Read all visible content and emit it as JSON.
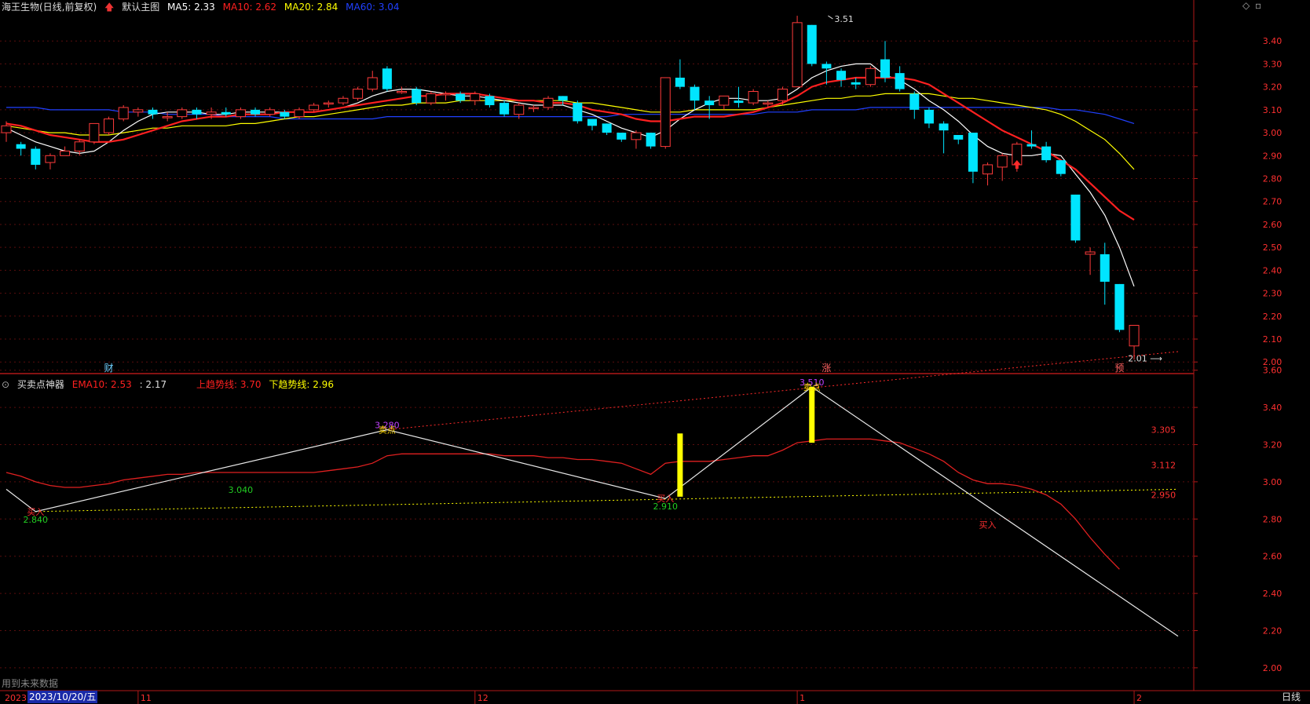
{
  "header": {
    "title": "海王生物(日线,前复权)",
    "template": "默认主图",
    "ma": [
      {
        "label": "MA5: 2.33",
        "color": "#ffffff"
      },
      {
        "label": "MA10: 2.62",
        "color": "#ff2020"
      },
      {
        "label": "MA20: 2.84",
        "color": "#ffff00"
      },
      {
        "label": "MA60: 3.04",
        "color": "#2040ff"
      }
    ]
  },
  "indicator_header": {
    "name": "买卖点神器",
    "ema_label": "EMA10: 2.53",
    "ema_color": "#ff2020",
    "val_label": ": 2.17",
    "up_label": "上趋势线: 3.70",
    "up_color": "#ff2020",
    "down_label": "下趋势线: 2.96",
    "down_color": "#ffff00"
  },
  "footer": {
    "future_note": "用到未来数据",
    "date": "2023/10/20/五",
    "year_stub": "2023",
    "timeframe": "日线"
  },
  "chart_data": [
    {
      "type": "candlestick",
      "title": "海王生物(日线,前复权)",
      "ylim": [
        1.97,
        3.5
      ],
      "yticks": [
        "3.40",
        "3.30",
        "3.20",
        "3.10",
        "3.00",
        "2.90",
        "2.80",
        "2.70",
        "2.60",
        "2.50",
        "2.40",
        "2.30",
        "2.20",
        "2.10",
        "2.00"
      ],
      "month_labels": [
        {
          "label": "11",
          "index": 9
        },
        {
          "label": "12",
          "index": 32
        },
        {
          "label": "1",
          "index": 54
        },
        {
          "label": "2",
          "index": 77
        }
      ],
      "event_marks": [
        {
          "label": "财",
          "index": 7
        },
        {
          "label": "涨",
          "index": 56
        },
        {
          "label": "预",
          "index": 76
        }
      ],
      "annotations": [
        {
          "label": "3.51",
          "index": 56,
          "y": 3.51
        },
        {
          "label": "2.01",
          "index": 80,
          "y": 2.01
        }
      ],
      "candles": [
        [
          3.0,
          3.03,
          3.05,
          2.96
        ],
        [
          2.95,
          2.93,
          2.96,
          2.9
        ],
        [
          2.93,
          2.86,
          2.94,
          2.84
        ],
        [
          2.87,
          2.9,
          2.91,
          2.84
        ],
        [
          2.9,
          2.92,
          2.94,
          2.9
        ],
        [
          2.92,
          2.96,
          2.97,
          2.9
        ],
        [
          2.96,
          3.04,
          3.04,
          2.95
        ],
        [
          3.0,
          3.06,
          3.07,
          2.99
        ],
        [
          3.06,
          3.11,
          3.12,
          3.05
        ],
        [
          3.09,
          3.1,
          3.11,
          3.07
        ],
        [
          3.1,
          3.08,
          3.11,
          3.06
        ],
        [
          3.07,
          3.07,
          3.09,
          3.05
        ],
        [
          3.07,
          3.1,
          3.11,
          3.06
        ],
        [
          3.1,
          3.08,
          3.11,
          3.06
        ],
        [
          3.08,
          3.09,
          3.11,
          3.06
        ],
        [
          3.09,
          3.08,
          3.11,
          3.07
        ],
        [
          3.07,
          3.1,
          3.11,
          3.06
        ],
        [
          3.1,
          3.08,
          3.11,
          3.07
        ],
        [
          3.08,
          3.1,
          3.11,
          3.07
        ],
        [
          3.09,
          3.07,
          3.1,
          3.06
        ],
        [
          3.07,
          3.1,
          3.11,
          3.06
        ],
        [
          3.1,
          3.12,
          3.13,
          3.09
        ],
        [
          3.13,
          3.13,
          3.14,
          3.11
        ],
        [
          3.13,
          3.15,
          3.16,
          3.12
        ],
        [
          3.15,
          3.19,
          3.2,
          3.14
        ],
        [
          3.19,
          3.24,
          3.27,
          3.18
        ],
        [
          3.28,
          3.19,
          3.29,
          3.18
        ],
        [
          3.18,
          3.18,
          3.2,
          3.17
        ],
        [
          3.19,
          3.13,
          3.2,
          3.12
        ],
        [
          3.13,
          3.17,
          3.18,
          3.12
        ],
        [
          3.17,
          3.17,
          3.18,
          3.14
        ],
        [
          3.17,
          3.14,
          3.18,
          3.13
        ],
        [
          3.14,
          3.17,
          3.18,
          3.12
        ],
        [
          3.16,
          3.12,
          3.17,
          3.11
        ],
        [
          3.13,
          3.08,
          3.14,
          3.07
        ],
        [
          3.08,
          3.12,
          3.13,
          3.06
        ],
        [
          3.11,
          3.11,
          3.12,
          3.09
        ],
        [
          3.11,
          3.15,
          3.16,
          3.1
        ],
        [
          3.16,
          3.14,
          3.16,
          3.12
        ],
        [
          3.13,
          3.05,
          3.14,
          3.04
        ],
        [
          3.06,
          3.03,
          3.06,
          3.01
        ],
        [
          3.04,
          3.0,
          3.04,
          2.99
        ],
        [
          3.0,
          2.97,
          3.0,
          2.96
        ],
        [
          2.97,
          3.0,
          3.01,
          2.93
        ],
        [
          3.0,
          2.94,
          3.0,
          2.93
        ],
        [
          2.94,
          3.24,
          3.24,
          2.93
        ],
        [
          3.24,
          3.2,
          3.32,
          3.19
        ],
        [
          3.2,
          3.14,
          3.21,
          3.1
        ],
        [
          3.14,
          3.12,
          3.16,
          3.06
        ],
        [
          3.12,
          3.16,
          3.16,
          3.1
        ],
        [
          3.14,
          3.13,
          3.2,
          3.11
        ],
        [
          3.13,
          3.18,
          3.19,
          3.12
        ],
        [
          3.13,
          3.13,
          3.14,
          3.11
        ],
        [
          3.14,
          3.19,
          3.2,
          3.12
        ],
        [
          3.2,
          3.48,
          3.51,
          3.2
        ],
        [
          3.47,
          3.3,
          3.47,
          3.29
        ],
        [
          3.3,
          3.28,
          3.31,
          3.21
        ],
        [
          3.27,
          3.23,
          3.28,
          3.2
        ],
        [
          3.22,
          3.21,
          3.24,
          3.19
        ],
        [
          3.21,
          3.28,
          3.29,
          3.2
        ],
        [
          3.32,
          3.24,
          3.4,
          3.22
        ],
        [
          3.26,
          3.19,
          3.29,
          3.18
        ],
        [
          3.17,
          3.1,
          3.18,
          3.06
        ],
        [
          3.1,
          3.04,
          3.11,
          3.02
        ],
        [
          3.04,
          3.01,
          3.05,
          2.91
        ],
        [
          2.99,
          2.97,
          2.99,
          2.95
        ],
        [
          3.0,
          2.83,
          3.0,
          2.78
        ],
        [
          2.82,
          2.86,
          2.87,
          2.77
        ],
        [
          2.85,
          2.9,
          2.91,
          2.79
        ],
        [
          2.86,
          2.95,
          2.96,
          2.83
        ],
        [
          2.95,
          2.94,
          3.01,
          2.93
        ],
        [
          2.94,
          2.88,
          2.96,
          2.87
        ],
        [
          2.88,
          2.82,
          2.88,
          2.81
        ],
        [
          2.73,
          2.53,
          2.73,
          2.52
        ],
        [
          2.47,
          2.48,
          2.5,
          2.38
        ],
        [
          2.47,
          2.35,
          2.52,
          2.25
        ],
        [
          2.34,
          2.14,
          2.34,
          2.13
        ],
        [
          2.07,
          2.16,
          2.16,
          2.01
        ]
      ],
      "series": [
        {
          "name": "MA5",
          "color": "#ffffff",
          "values": [
            3.02,
            2.99,
            2.96,
            2.94,
            2.92,
            2.91,
            2.92,
            2.96,
            3.01,
            3.05,
            3.08,
            3.09,
            3.09,
            3.09,
            3.08,
            3.08,
            3.09,
            3.09,
            3.09,
            3.09,
            3.09,
            3.09,
            3.1,
            3.11,
            3.13,
            3.16,
            3.18,
            3.19,
            3.19,
            3.18,
            3.17,
            3.16,
            3.16,
            3.15,
            3.14,
            3.13,
            3.12,
            3.12,
            3.12,
            3.1,
            3.08,
            3.05,
            3.02,
            3.0,
            2.98,
            3.01,
            3.06,
            3.1,
            3.13,
            3.15,
            3.15,
            3.14,
            3.14,
            3.15,
            3.19,
            3.24,
            3.27,
            3.29,
            3.3,
            3.3,
            3.25,
            3.23,
            3.19,
            3.14,
            3.1,
            3.05,
            2.99,
            2.94,
            2.91,
            2.9,
            2.9,
            2.91,
            2.9,
            2.82,
            2.74,
            2.64,
            2.5,
            2.33
          ]
        },
        {
          "name": "MA10",
          "color": "#ff2020",
          "values": [
            3.04,
            3.03,
            3.01,
            2.99,
            2.98,
            2.97,
            2.96,
            2.96,
            2.97,
            2.99,
            3.01,
            3.03,
            3.05,
            3.06,
            3.07,
            3.07,
            3.08,
            3.08,
            3.08,
            3.09,
            3.09,
            3.09,
            3.1,
            3.11,
            3.12,
            3.13,
            3.14,
            3.15,
            3.16,
            3.16,
            3.17,
            3.17,
            3.17,
            3.16,
            3.15,
            3.14,
            3.14,
            3.13,
            3.13,
            3.12,
            3.1,
            3.09,
            3.08,
            3.06,
            3.05,
            3.05,
            3.06,
            3.07,
            3.07,
            3.07,
            3.08,
            3.09,
            3.11,
            3.13,
            3.16,
            3.2,
            3.22,
            3.23,
            3.24,
            3.24,
            3.24,
            3.24,
            3.23,
            3.21,
            3.17,
            3.13,
            3.09,
            3.05,
            3.01,
            2.98,
            2.95,
            2.92,
            2.88,
            2.84,
            2.78,
            2.72,
            2.66,
            2.62
          ]
        },
        {
          "name": "MA20",
          "color": "#ffff00",
          "values": [
            3.03,
            3.02,
            3.01,
            3.0,
            3.0,
            2.99,
            2.99,
            2.99,
            3.0,
            3.01,
            3.02,
            3.02,
            3.03,
            3.03,
            3.03,
            3.03,
            3.04,
            3.04,
            3.05,
            3.06,
            3.07,
            3.07,
            3.08,
            3.09,
            3.1,
            3.11,
            3.12,
            3.12,
            3.13,
            3.13,
            3.13,
            3.14,
            3.14,
            3.14,
            3.14,
            3.14,
            3.14,
            3.14,
            3.14,
            3.13,
            3.13,
            3.12,
            3.11,
            3.1,
            3.09,
            3.09,
            3.09,
            3.1,
            3.1,
            3.1,
            3.1,
            3.1,
            3.11,
            3.12,
            3.13,
            3.14,
            3.15,
            3.15,
            3.16,
            3.16,
            3.17,
            3.17,
            3.17,
            3.17,
            3.16,
            3.15,
            3.15,
            3.14,
            3.13,
            3.12,
            3.11,
            3.1,
            3.08,
            3.05,
            3.01,
            2.97,
            2.91,
            2.84
          ]
        },
        {
          "name": "MA60",
          "color": "#2040ff",
          "values": [
            3.11,
            3.11,
            3.11,
            3.1,
            3.1,
            3.1,
            3.1,
            3.1,
            3.09,
            3.09,
            3.09,
            3.08,
            3.08,
            3.08,
            3.08,
            3.07,
            3.07,
            3.07,
            3.07,
            3.06,
            3.06,
            3.06,
            3.06,
            3.06,
            3.06,
            3.06,
            3.07,
            3.07,
            3.07,
            3.07,
            3.07,
            3.07,
            3.07,
            3.07,
            3.07,
            3.07,
            3.07,
            3.07,
            3.07,
            3.07,
            3.07,
            3.07,
            3.08,
            3.08,
            3.08,
            3.08,
            3.08,
            3.08,
            3.08,
            3.08,
            3.08,
            3.08,
            3.09,
            3.09,
            3.09,
            3.1,
            3.1,
            3.1,
            3.1,
            3.11,
            3.11,
            3.11,
            3.11,
            3.11,
            3.11,
            3.11,
            3.11,
            3.11,
            3.11,
            3.11,
            3.11,
            3.11,
            3.1,
            3.1,
            3.09,
            3.08,
            3.06,
            3.04
          ]
        }
      ]
    },
    {
      "type": "line",
      "title": "买卖点神器",
      "ylim": [
        1.97,
        3.7
      ],
      "yticks": [
        "3.60",
        "3.40",
        "3.20",
        "3.00",
        "2.80",
        "2.60",
        "2.40",
        "2.20",
        "2.00"
      ],
      "ema10": [
        3.05,
        3.03,
        3.0,
        2.98,
        2.97,
        2.97,
        2.98,
        2.99,
        3.01,
        3.02,
        3.03,
        3.04,
        3.04,
        3.05,
        3.05,
        3.05,
        3.05,
        3.05,
        3.05,
        3.05,
        3.05,
        3.05,
        3.06,
        3.07,
        3.08,
        3.1,
        3.14,
        3.15,
        3.15,
        3.15,
        3.15,
        3.15,
        3.15,
        3.15,
        3.14,
        3.14,
        3.14,
        3.13,
        3.13,
        3.12,
        3.12,
        3.11,
        3.1,
        3.07,
        3.04,
        3.1,
        3.11,
        3.11,
        3.11,
        3.12,
        3.13,
        3.14,
        3.14,
        3.17,
        3.21,
        3.22,
        3.23,
        3.23,
        3.23,
        3.23,
        3.22,
        3.21,
        3.18,
        3.15,
        3.11,
        3.05,
        3.01,
        2.99,
        2.99,
        2.98,
        2.96,
        2.93,
        2.88,
        2.8,
        2.7,
        2.61,
        2.53
      ],
      "zigzag": [
        [
          0,
          2.96
        ],
        [
          2,
          2.84
        ],
        [
          26,
          3.28
        ],
        [
          45,
          2.91
        ],
        [
          55,
          3.51
        ],
        [
          80,
          2.17
        ]
      ],
      "up_trend": [
        [
          26,
          3.28
        ],
        [
          80,
          3.7
        ]
      ],
      "down_trend": [
        [
          2,
          2.84
        ],
        [
          80,
          2.96
        ]
      ],
      "signal_bars": [
        [
          46,
          2.92,
          3.26
        ],
        [
          55,
          3.21,
          3.51
        ]
      ],
      "point_labels": [
        {
          "label": "3.280",
          "index": 26,
          "y": 3.28,
          "color": "#c040ff"
        },
        {
          "label": "3.510",
          "index": 55,
          "y": 3.51,
          "color": "#c040ff"
        },
        {
          "label": "3.040",
          "index": 16,
          "y": 3.0,
          "color": "#22cc22"
        },
        {
          "label": "2.840",
          "index": 2,
          "y": 2.84,
          "color": "#22cc22"
        },
        {
          "label": "2.910",
          "index": 45,
          "y": 2.91,
          "color": "#22cc22"
        },
        {
          "label": "3.305",
          "index": 79,
          "y": 3.28,
          "color": "#ff3030"
        },
        {
          "label": "3.112",
          "index": 79,
          "y": 3.09,
          "color": "#ff3030"
        },
        {
          "label": "2.950",
          "index": 79,
          "y": 2.93,
          "color": "#ff3030"
        }
      ],
      "signals": [
        {
          "label": "买入",
          "index": 2,
          "y": 2.84,
          "color": "#ff3030"
        },
        {
          "label": "卖点",
          "index": 26,
          "y": 3.28,
          "color": "#ffd700"
        },
        {
          "label": "买入",
          "index": 45,
          "y": 2.91,
          "color": "#ff3030"
        },
        {
          "label": "卖点",
          "index": 55,
          "y": 3.51,
          "color": "#ffd700"
        },
        {
          "label": "买入",
          "index": 67,
          "y": 2.77,
          "color": "#ff3030"
        }
      ]
    }
  ]
}
